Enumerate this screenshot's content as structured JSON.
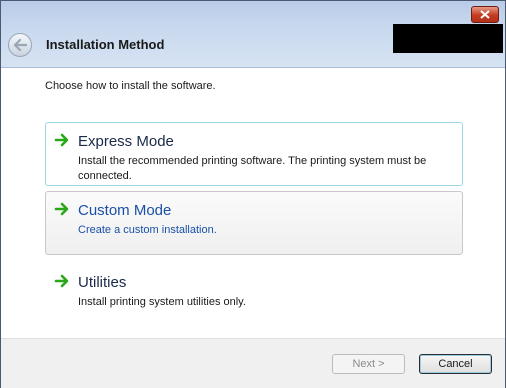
{
  "window": {
    "title": "Installation Method"
  },
  "intro": "Choose how to install the software.",
  "options": [
    {
      "label": "Express Mode",
      "description": "Install the recommended printing software. The printing system must be connected."
    },
    {
      "label": "Custom Mode",
      "description": "Create a custom installation."
    },
    {
      "label": "Utilities",
      "description": "Install printing system utilities only."
    }
  ],
  "buttons": {
    "next": "Next >",
    "cancel": "Cancel"
  },
  "colors": {
    "arrow": "#2aa81a",
    "custom_text": "#1a4fa8"
  },
  "icons": {
    "close": "close-icon",
    "back": "back-arrow-icon",
    "option": "green-arrow-icon"
  }
}
